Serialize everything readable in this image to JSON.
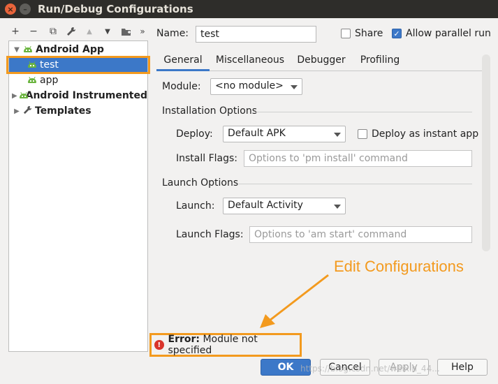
{
  "window": {
    "title": "Run/Debug Configurations"
  },
  "toolbar": {
    "icons": [
      "add-icon",
      "remove-icon",
      "copy-icon",
      "wrench-icon",
      "move-up-icon",
      "move-down-icon",
      "folder-add-icon",
      "more-icon"
    ],
    "glyphs": {
      "add": "+",
      "remove": "−",
      "copy": "⧉",
      "wrench": "🔧",
      "up": "▲",
      "down": "▼",
      "folder": "▣",
      "more": "»"
    }
  },
  "tree": {
    "items": [
      {
        "label": "Android App",
        "expanded": true
      },
      {
        "label": "test",
        "selected": true
      },
      {
        "label": "app"
      },
      {
        "label": "Android Instrumented"
      },
      {
        "label": "Templates"
      }
    ]
  },
  "form": {
    "name_label": "Name:",
    "name_value": "test",
    "share_label": "Share",
    "share_checked": false,
    "parallel_label": "Allow parallel run",
    "parallel_checked": true
  },
  "tabs": [
    "General",
    "Miscellaneous",
    "Debugger",
    "Profiling"
  ],
  "general": {
    "module_label": "Module:",
    "module_value": "<no module>",
    "installation_heading": "Installation Options",
    "deploy_label": "Deploy:",
    "deploy_value": "Default APK",
    "instant_label": "Deploy as instant app",
    "install_flags_label": "Install Flags:",
    "install_flags_placeholder": "Options to 'pm install' command",
    "launch_heading": "Launch Options",
    "launch_label": "Launch:",
    "launch_value": "Default Activity",
    "launch_flags_label": "Launch Flags:",
    "launch_flags_placeholder": "Options to 'am start' command"
  },
  "annotation": {
    "text": "Edit Configurations",
    "color": "#f39a1e"
  },
  "error": {
    "prefix": "Error:",
    "message": "Module not specified"
  },
  "buttons": {
    "ok": "OK",
    "cancel": "Cancel",
    "apply": "Apply",
    "help": "Help"
  },
  "watermark": "https://blog.csdn.net/weixin_44...",
  "colors": {
    "accent": "#3c78c8",
    "highlight": "#f39a1e",
    "error": "#d9342b",
    "android_green": "#6ab43e"
  }
}
